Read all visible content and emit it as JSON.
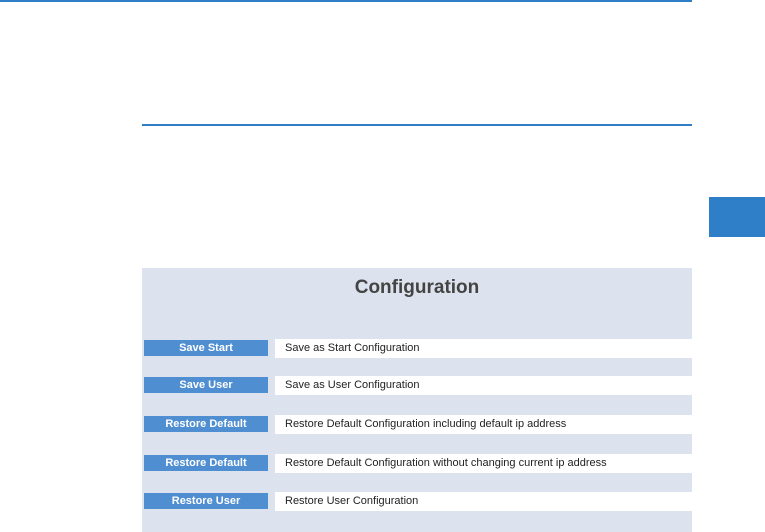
{
  "panel": {
    "title": "Configuration",
    "rows": [
      {
        "button": "Save Start",
        "description": "Save as Start Configuration"
      },
      {
        "button": "Save User",
        "description": "Save as User Configuration"
      },
      {
        "button": "Restore Default",
        "description": "Restore Default Configuration including default ip address"
      },
      {
        "button": "Restore Default",
        "description": "Restore Default Configuration without changing current ip address"
      },
      {
        "button": "Restore User",
        "description": "Restore User Configuration"
      }
    ]
  },
  "colors": {
    "accent": "#2f7fc8",
    "button": "#4f8ed0",
    "panel_bg": "#dde3ee"
  }
}
